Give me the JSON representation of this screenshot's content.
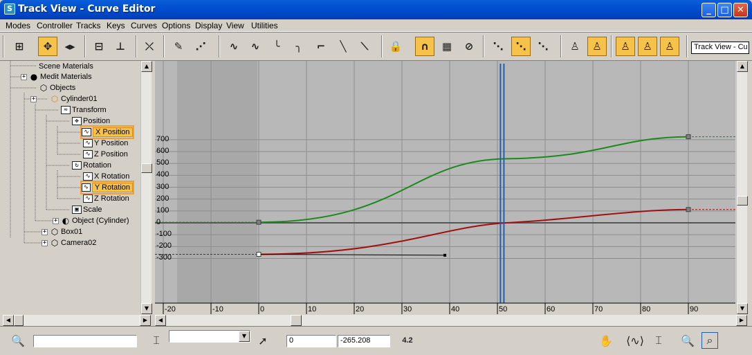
{
  "window": {
    "title": "Track View - Curve Editor",
    "app_icon": "S"
  },
  "menu": [
    "Modes",
    "Controller",
    "Tracks",
    "Keys",
    "Curves",
    "Options",
    "Display",
    "View",
    "Utilities"
  ],
  "toolbar": {
    "track_view_name": "Track View - Cu"
  },
  "hierarchy": {
    "scene_materials": "Scene Materials",
    "medit_materials": "Medit Materials",
    "objects": "Objects",
    "cylinder": "Cylinder01",
    "transform": "Transform",
    "position": "Position",
    "x_position": "X Position",
    "y_position": "Y Position",
    "z_position": "Z Position",
    "rotation": "Rotation",
    "x_rotation": "X Rotation",
    "y_rotation": "Y Rotation",
    "z_rotation": "Z Rotation",
    "scale": "Scale",
    "object_cylinder": "Object (Cylinder)",
    "box": "Box01",
    "camera": "Camera02"
  },
  "graph": {
    "y_ticks": [
      "700",
      "600",
      "500",
      "400",
      "300",
      "200",
      "100",
      "0",
      "-100",
      "-200",
      "-300"
    ],
    "x_ticks": [
      "-20",
      "-10",
      "0",
      "10",
      "20",
      "30",
      "40",
      "50",
      "60",
      "70",
      "80",
      "90"
    ],
    "time_slider_frame": 51,
    "colors": {
      "x_position_curve": "#1a8a1a",
      "y_rotation_curve": "#a01010",
      "time_slider": "#1f5fb0",
      "background": "#b8b8b8",
      "out_of_range": "#a8a8a8"
    }
  },
  "status": {
    "frame_value": "0",
    "key_value": "-265.208",
    "zoom_value": "4.2"
  }
}
